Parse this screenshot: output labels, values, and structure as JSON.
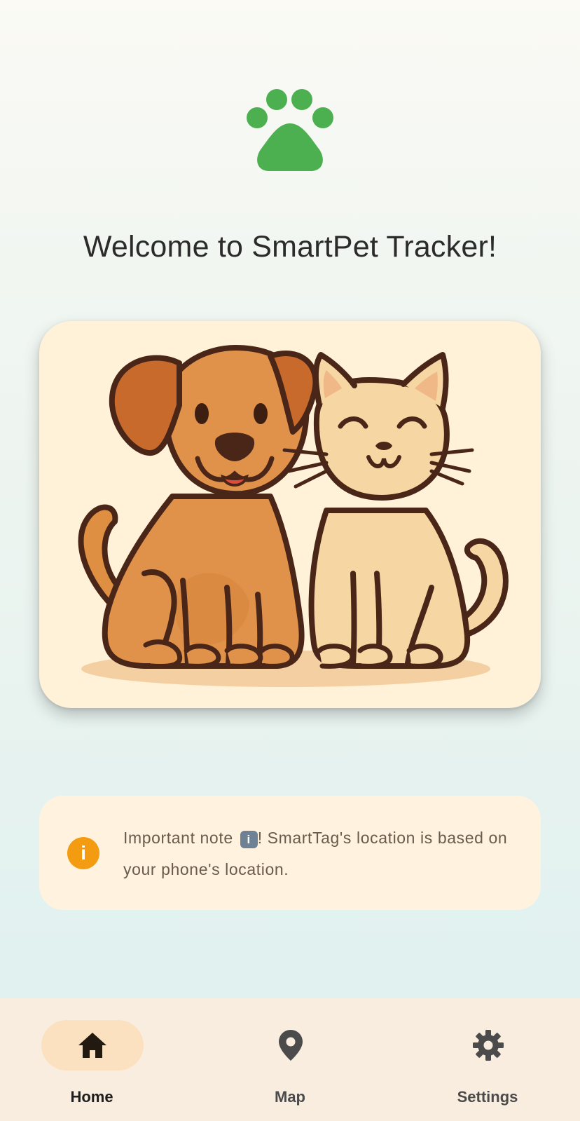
{
  "header": {
    "logo_icon": "paw-icon",
    "logo_color": "#4caf50",
    "title": "Welcome to SmartPet Tracker!"
  },
  "illustration": {
    "icon": "dog-and-cat-illustration"
  },
  "note": {
    "icon": "info-icon",
    "icon_color": "#f39c12",
    "text_before": "Important note ",
    "emoji_label": "i",
    "text_after": "! SmartTag's location is based on your phone's location."
  },
  "bottom_nav": {
    "items": [
      {
        "label": "Home",
        "icon": "home-icon",
        "active": true
      },
      {
        "label": "Map",
        "icon": "map-pin-icon",
        "active": false
      },
      {
        "label": "Settings",
        "icon": "gear-icon",
        "active": false
      }
    ],
    "active_pill_color": "#fbe1c0"
  }
}
